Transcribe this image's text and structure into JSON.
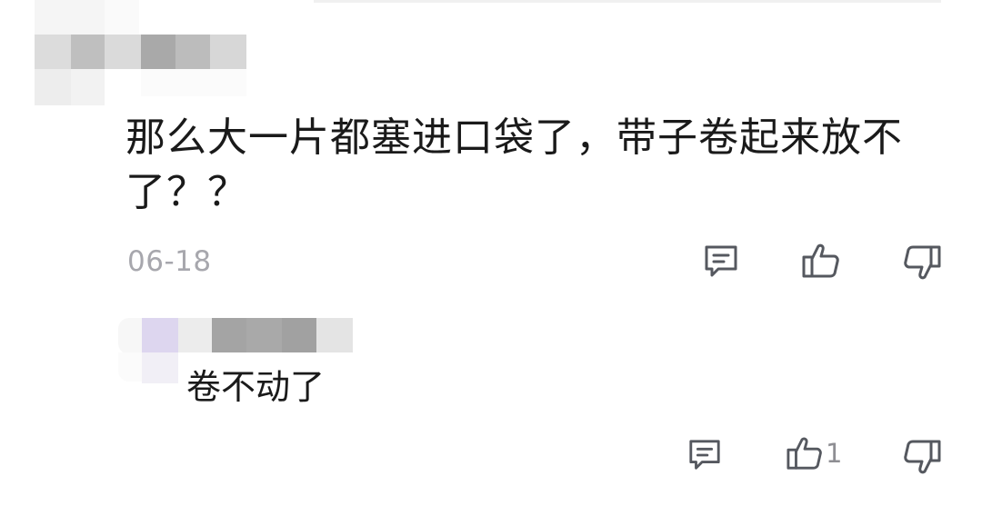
{
  "comment": {
    "username_state": "obscured",
    "text": "那么大一片都塞进口袋了，带子卷起来放不了？？",
    "date": "06-18",
    "actions": {
      "reply_icon": "comment-icon",
      "like_icon": "thumbs-up-icon",
      "dislike_icon": "thumbs-down-icon"
    }
  },
  "reply": {
    "username_state": "obscured",
    "text": "卷不动了",
    "actions": {
      "reply_icon": "comment-icon",
      "like_icon": "thumbs-up-icon",
      "like_count": "1",
      "dislike_icon": "thumbs-down-icon"
    }
  },
  "colors": {
    "text": "#1a1a1a",
    "meta": "#a7a7ad",
    "icon": "#55585f",
    "avatar_tint": "#ddd6ef"
  }
}
